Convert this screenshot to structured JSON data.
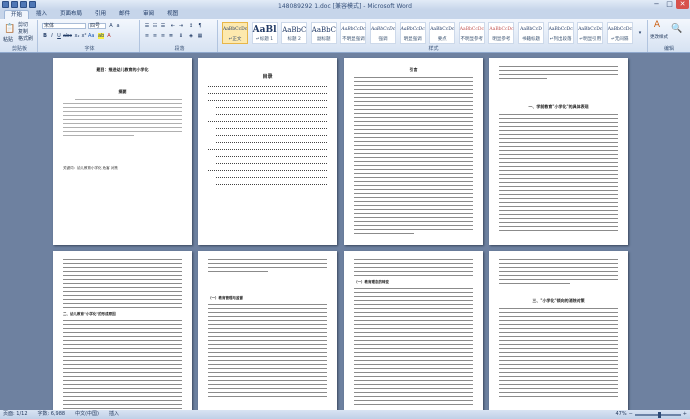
{
  "window": {
    "title": "148089292 1.doc [兼容模式] - Microsoft Word"
  },
  "tabs": [
    "开始",
    "插入",
    "页面布局",
    "引用",
    "邮件",
    "审阅",
    "视图"
  ],
  "active_tab": 0,
  "clipboard": {
    "paste": "粘贴",
    "cut": "剪切",
    "copy": "复制",
    "format_painter": "格式刷",
    "label": "剪贴板"
  },
  "font": {
    "name": "宋体",
    "size": "四号",
    "label": "字体"
  },
  "paragraph": {
    "label": "段落"
  },
  "styles": {
    "label": "样式",
    "items": [
      {
        "preview": "AaBbCcDc",
        "name": "↵正文"
      },
      {
        "preview": "AaBl",
        "name": "↵标题 1"
      },
      {
        "preview": "AaBbC",
        "name": "标题 2"
      },
      {
        "preview": "AaBbC",
        "name": "副标题"
      },
      {
        "preview": "AaBbCcDc",
        "name": "不明显强调"
      },
      {
        "preview": "AaBbCcDc",
        "name": "强调"
      },
      {
        "preview": "AaBbCcDc",
        "name": "明显强调"
      },
      {
        "preview": "AaBbCcDc",
        "name": "要点"
      },
      {
        "preview": "AaBbCcDc",
        "name": "不明显参考"
      },
      {
        "preview": "AaBbCcDc",
        "name": "明显参考"
      },
      {
        "preview": "AaBbCcD",
        "name": "书籍标题"
      },
      {
        "preview": "AaBbCcDc",
        "name": "↵列出段落"
      },
      {
        "preview": "AaBbCcDc",
        "name": "↵明显引用"
      },
      {
        "preview": "AaBbCcDc",
        "name": "↵无间隔"
      }
    ]
  },
  "change_styles": "更改样式",
  "editing": {
    "label": "编辑"
  },
  "pages": [
    {
      "heading": "题目：推进幼儿教育的小学化",
      "sub": "摘要",
      "keywords": "关键词：幼儿教育小学化 危害 对策"
    },
    {
      "heading": "目录",
      "sub": ""
    },
    {
      "heading": "引言",
      "sub": ""
    },
    {
      "heading": "",
      "sub": "一、学前教育\"小学化\"的具体表现"
    }
  ],
  "pages_row2": [
    {
      "sub": "二、幼儿教育\"小学化\"的形成原因"
    },
    {
      "sub": "（一）教育管理与监督"
    },
    {
      "sub": "（一）教育理念的转变"
    },
    {
      "sub": "三、\"小学化\"倾向的消除对策"
    }
  ],
  "status": {
    "page": "页面: 1/12",
    "words": "字数: 6,988",
    "lang": "中文(中国)",
    "insert": "插入",
    "zoom": "47%"
  }
}
